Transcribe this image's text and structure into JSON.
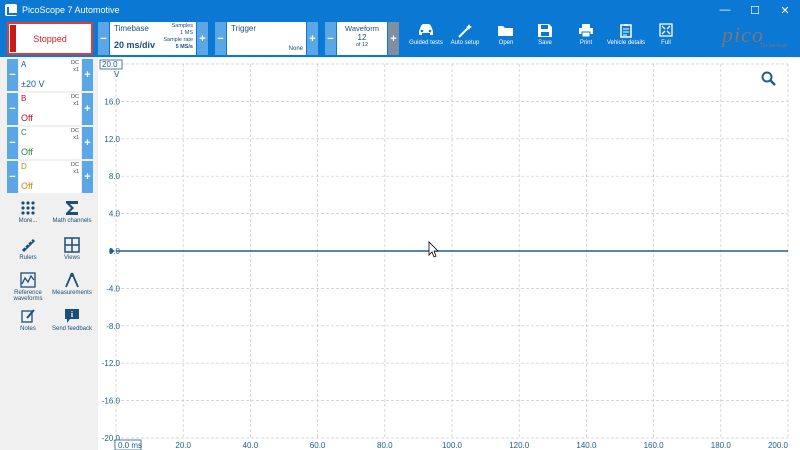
{
  "window": {
    "title": "PicoScope 7 Automotive",
    "min": "—",
    "max": "☐",
    "close": "✕"
  },
  "run": {
    "label": "Stopped"
  },
  "timebase": {
    "label": "Timebase",
    "value": "20 ms/div",
    "samples_label": "Samples",
    "samples_value": "1 MS",
    "rate_label": "Sample rate",
    "rate_value": "5 MS/s"
  },
  "trigger": {
    "label": "Trigger",
    "value": "None"
  },
  "waveform": {
    "label": "Waveform",
    "current": "12",
    "of": "of 12"
  },
  "toolbar": [
    {
      "label": "Guided tests",
      "icon": "car-icon"
    },
    {
      "label": "Auto setup",
      "icon": "wand-icon"
    },
    {
      "label": "Open",
      "icon": "folder-icon"
    },
    {
      "label": "Save",
      "icon": "save-icon"
    },
    {
      "label": "Print",
      "icon": "print-icon"
    },
    {
      "label": "Vehicle details",
      "icon": "clipboard-icon"
    },
    {
      "label": "Full",
      "icon": "fullscreen-icon"
    }
  ],
  "logo": {
    "text": "pico",
    "sub": "Technology"
  },
  "channels": [
    {
      "name": "A",
      "coupling": "DC",
      "probe": "x1",
      "range": "±20 V",
      "color": "#1a5a8c"
    },
    {
      "name": "B",
      "coupling": "DC",
      "probe": "x1",
      "range": "Off",
      "color": "#c0102a"
    },
    {
      "name": "C",
      "coupling": "DC",
      "probe": "x1",
      "range": "Off",
      "color": "#2a8a3a"
    },
    {
      "name": "D",
      "coupling": "DC",
      "probe": "x1",
      "range": "Off",
      "color": "#c98a10"
    }
  ],
  "tools": [
    {
      "label": "More...",
      "icon": "grid-dots-icon"
    },
    {
      "label": "Math channels",
      "icon": "sigma-icon"
    },
    {
      "label": "Rulers",
      "icon": "ruler-icon"
    },
    {
      "label": "Views",
      "icon": "views-icon"
    },
    {
      "label": "Reference waveforms",
      "icon": "reference-waveform-icon"
    },
    {
      "label": "Measurements",
      "icon": "caliper-icon"
    },
    {
      "label": "Notes",
      "icon": "notes-icon"
    },
    {
      "label": "Send feedback",
      "icon": "feedback-icon"
    }
  ],
  "chart_data": {
    "type": "line",
    "ylabel": "V",
    "xlabel": "ms",
    "ylim": [
      -20,
      20
    ],
    "xlim": [
      0,
      200
    ],
    "y_ticks": [
      "20.0",
      "16.0",
      "12.0",
      "8.0",
      "4.0",
      "0.0",
      "-4.0",
      "-8.0",
      "-12.0",
      "-16.0",
      "-20.0"
    ],
    "x_ticks": [
      "0.0 ms",
      "20.0",
      "40.0",
      "60.0",
      "80.0",
      "100.0",
      "120.0",
      "140.0",
      "160.0",
      "180.0",
      "200.0"
    ],
    "grid": true,
    "series": [
      {
        "name": "A",
        "color": "#1f5f8b",
        "x": [
          0,
          50,
          100,
          150,
          200
        ],
        "y": [
          0,
          0,
          0,
          0,
          0
        ]
      }
    ]
  }
}
